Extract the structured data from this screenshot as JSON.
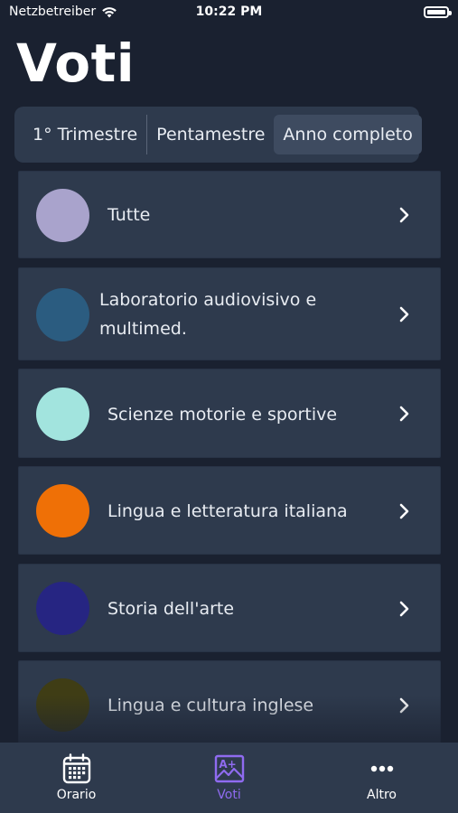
{
  "status": {
    "carrier": "Netzbetreiber",
    "time": "10:22 PM"
  },
  "title": "Voti",
  "segments": [
    {
      "label": "1° Trimestre",
      "active": false
    },
    {
      "label": "Pentamestre",
      "active": false
    },
    {
      "label": "Anno completo",
      "active": true
    }
  ],
  "subjects": [
    {
      "label": "Tutte",
      "color": "#a9a3cc"
    },
    {
      "label": "Laboratorio audiovisivo e",
      "label2": "multimed.",
      "color": "#2b5c80"
    },
    {
      "label": "Scienze motorie e sportive",
      "color": "#a2e4de"
    },
    {
      "label": "Lingua e letteratura italiana",
      "color": "#ef7006"
    },
    {
      "label": "Storia dell'arte",
      "color": "#262582"
    },
    {
      "label": "Lingua e cultura inglese",
      "color": "#3f3d15"
    }
  ],
  "tabs": [
    {
      "label": "Orario",
      "icon": "calendar-icon",
      "active": false
    },
    {
      "label": "Voti",
      "icon": "grade-icon",
      "active": true
    },
    {
      "label": "Altro",
      "icon": "more-icon",
      "active": false
    }
  ],
  "colors": {
    "background": "#1a2130",
    "card": "#2e3a4d",
    "accent": "#8f6bf0"
  }
}
